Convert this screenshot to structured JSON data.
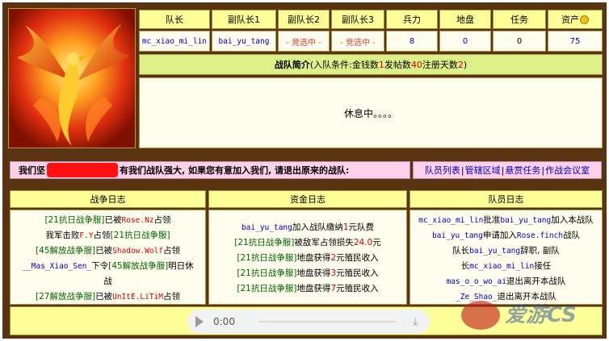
{
  "header_cols": [
    {
      "label": "队长"
    },
    {
      "label": "副队长1"
    },
    {
      "label": "副队长2"
    },
    {
      "label": "副队长3"
    },
    {
      "label": "兵力"
    },
    {
      "label": "地盘"
    },
    {
      "label": "任务"
    },
    {
      "label": "资产"
    }
  ],
  "values": {
    "captain": "mc_xiao_mi_lin",
    "vice1": "bai_yu_tang",
    "vice2": "- 竞选中 -",
    "vice3": "- 竞选中 -",
    "troops": "8",
    "territory": "0",
    "tasks": "0",
    "assets": "75"
  },
  "intro": {
    "title": "战队简介",
    "cond_open": " (入队条件:金钱数",
    "money": "1",
    "posts_label": " 发帖数",
    "posts": "40",
    "days_label": " 注册天数",
    "days": "2",
    "cond_close": ")",
    "body": "休息中。。。。"
  },
  "recruit": {
    "prefix": "我们坚",
    "suffix": "有我们战队强大, 如果您有意加入我们, 请退出原来的战队:"
  },
  "links": [
    {
      "label": "队员列表"
    },
    {
      "label": "管辖区域"
    },
    {
      "label": "悬赏任务"
    },
    {
      "label": "作战会议室"
    }
  ],
  "war_log": {
    "title": "战争日志",
    "lines": [
      [
        {
          "t": "[21抗日战争服]",
          "c": "green"
        },
        {
          "t": "已被",
          "c": ""
        },
        {
          "t": "Rose.Nz",
          "c": "red mono"
        },
        {
          "t": "占领",
          "c": ""
        }
      ],
      [
        {
          "t": "我军击败",
          "c": ""
        },
        {
          "t": "F.Y",
          "c": "red mono"
        },
        {
          "t": "占领",
          "c": ""
        },
        {
          "t": "[21抗日战争服]",
          "c": "green"
        }
      ],
      [
        {
          "t": "[45解放战争服]",
          "c": "green"
        },
        {
          "t": "已被",
          "c": ""
        },
        {
          "t": "Shadow.Wolf",
          "c": "red mono"
        },
        {
          "t": "占领",
          "c": ""
        }
      ],
      [
        {
          "t": "__Mas_Xiao_Sen_",
          "c": "blue mono"
        },
        {
          "t": "下令",
          "c": ""
        },
        {
          "t": "[45解放战争服]",
          "c": "green"
        },
        {
          "t": "明日休",
          "c": ""
        }
      ],
      [
        {
          "t": "战",
          "c": ""
        }
      ],
      [
        {
          "t": "[27解放战争服]",
          "c": "green"
        },
        {
          "t": "已被",
          "c": ""
        },
        {
          "t": "UnItE.LiTiM",
          "c": "red mono"
        },
        {
          "t": "占领",
          "c": ""
        }
      ]
    ]
  },
  "fund_log": {
    "title": "资金日志",
    "lines": [
      [
        {
          "t": "bai_yu_tang",
          "c": "blue mono"
        },
        {
          "t": "加入战队缴纳",
          "c": ""
        },
        {
          "t": "1",
          "c": "red"
        },
        {
          "t": "元队费",
          "c": ""
        }
      ],
      [
        {
          "t": "[21抗日战争服]",
          "c": "green"
        },
        {
          "t": "被敌军占领损失",
          "c": ""
        },
        {
          "t": "24.0",
          "c": "red"
        },
        {
          "t": "元",
          "c": ""
        }
      ],
      [
        {
          "t": "[21抗日战争服]",
          "c": "green"
        },
        {
          "t": "地盘获得",
          "c": ""
        },
        {
          "t": "2",
          "c": "red"
        },
        {
          "t": "元殖民收入",
          "c": ""
        }
      ],
      [
        {
          "t": "[21抗日战争服]",
          "c": "green"
        },
        {
          "t": "地盘获得",
          "c": ""
        },
        {
          "t": "3",
          "c": "red"
        },
        {
          "t": "元殖民收入",
          "c": ""
        }
      ],
      [
        {
          "t": "[21抗日战争服]",
          "c": "green"
        },
        {
          "t": "地盘获得",
          "c": ""
        },
        {
          "t": "7",
          "c": "red"
        },
        {
          "t": "元殖民收入",
          "c": ""
        }
      ]
    ]
  },
  "member_log": {
    "title": "队员日志",
    "lines": [
      [
        {
          "t": "mc_xiao_mi_lin",
          "c": "blue mono"
        },
        {
          "t": "批准",
          "c": ""
        },
        {
          "t": "bai_yu_tang",
          "c": "blue mono"
        },
        {
          "t": "加入本战队",
          "c": ""
        }
      ],
      [
        {
          "t": "bai_yu_tang",
          "c": "blue mono"
        },
        {
          "t": "申请加入",
          "c": ""
        },
        {
          "t": "Rose.finch",
          "c": "blue mono"
        },
        {
          "t": "战队",
          "c": ""
        }
      ],
      [
        {
          "t": "队长",
          "c": ""
        },
        {
          "t": "bai_yu_tang",
          "c": "blue mono"
        },
        {
          "t": "辞职, 副队",
          "c": ""
        }
      ],
      [
        {
          "t": "长",
          "c": ""
        },
        {
          "t": "mc_xiao_mi_lin",
          "c": "blue mono"
        },
        {
          "t": "接任",
          "c": ""
        }
      ],
      [
        {
          "t": "mas_o_o_wo_ai",
          "c": "blue mono"
        },
        {
          "t": "退出离开本战队",
          "c": ""
        }
      ],
      [
        {
          "t": "_Ze_Shao_",
          "c": "blue mono"
        },
        {
          "t": "退出离开本战队",
          "c": ""
        }
      ]
    ]
  },
  "audio": {
    "time": "0:00"
  },
  "watermark": {
    "text": "爱游CS"
  },
  "colors": {
    "frame": "#5a3410",
    "header": "#ffff9a",
    "cell": "#fffeee",
    "pink": "#ffd0ea",
    "red": "#d00000",
    "blue": "#0000c0",
    "green": "#006400"
  }
}
